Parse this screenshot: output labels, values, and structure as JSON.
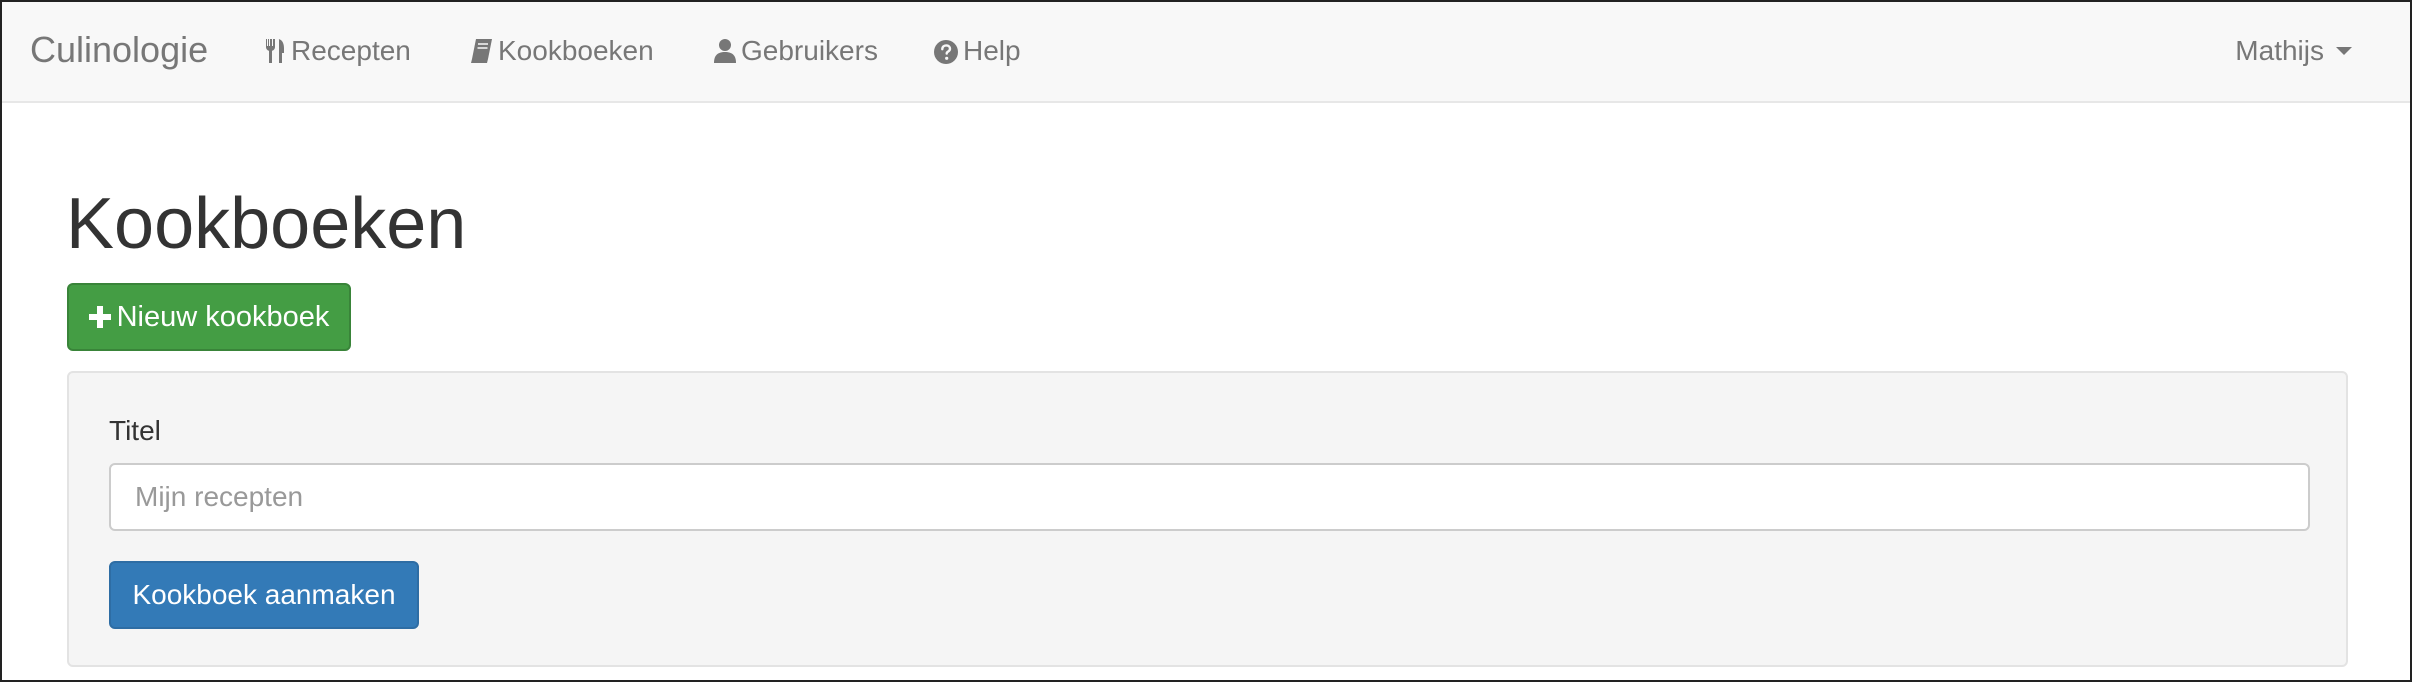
{
  "navbar": {
    "brand": "Culinologie",
    "links": [
      {
        "label": "Recepten",
        "icon": "cutlery-icon"
      },
      {
        "label": "Kookboeken",
        "icon": "book-icon"
      },
      {
        "label": "Gebruikers",
        "icon": "user-icon"
      },
      {
        "label": "Help",
        "icon": "question-circle-icon"
      }
    ],
    "user": "Mathijs"
  },
  "main": {
    "title": "Kookboeken",
    "new_button": "Nieuw kookboek",
    "form": {
      "title_label": "Titel",
      "title_placeholder": "Mijn recepten",
      "title_value": "",
      "submit_label": "Kookboek aanmaken"
    }
  },
  "colors": {
    "navbar_bg": "#f8f8f8",
    "success": "#449d44",
    "primary": "#337ab7",
    "panel_bg": "#f5f5f5"
  }
}
